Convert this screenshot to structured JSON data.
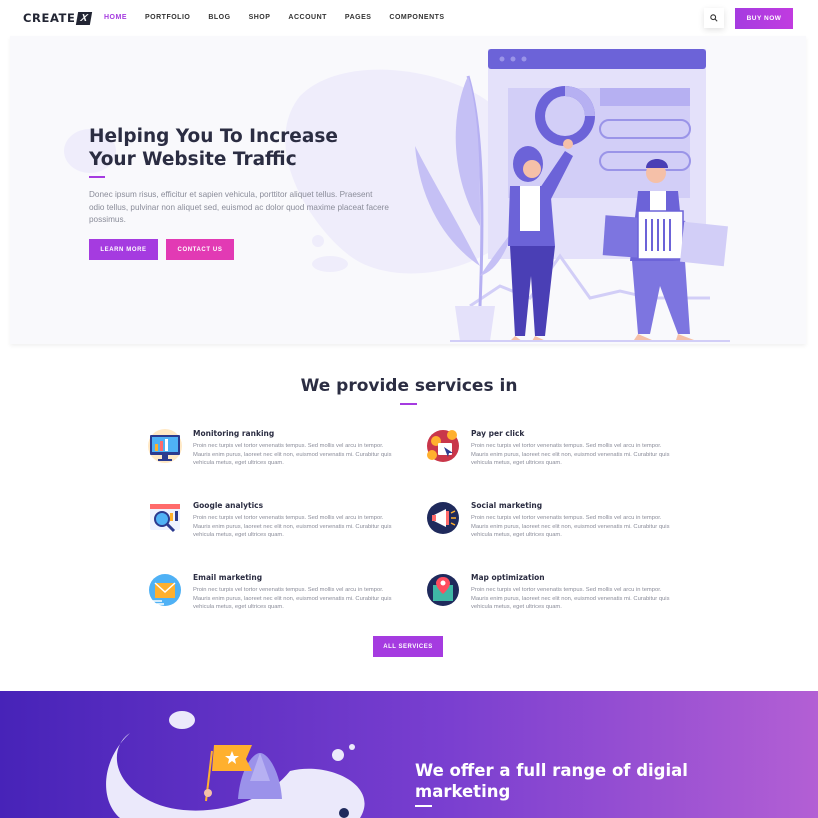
{
  "nav": {
    "logo_text": "CREATE",
    "logo_mark": "X",
    "items": [
      "HOME",
      "PORTFOLIO",
      "BLOG",
      "SHOP",
      "ACCOUNT",
      "PAGES",
      "COMPONENTS"
    ],
    "active_item": "HOME",
    "search_icon": "search-icon",
    "buy_label": "BUY NOW"
  },
  "hero": {
    "title": "Helping You To Increase Your Website Traffic",
    "text": "Donec ipsum risus, efficitur et sapien vehicula, porttitor aliquet tellus. Praesent odio tellus, pulvinar non aliquet sed, euismod ac dolor quod maxime placeat facere possimus.",
    "learn_more": "LEARN MORE",
    "contact_us": "CONTACT US"
  },
  "services": {
    "title": "We provide services in",
    "items": [
      {
        "title": "Monitoring ranking",
        "icon": "monitor-chart-icon",
        "desc": "Proin nec turpis vel tortor venenatis tempus. Sed mollis vel arcu in tempor. Mauris enim purus, laoreet nec elit non, euismod venenatis mi. Curabitur quis vehicula metus, eget ultrices quam."
      },
      {
        "title": "Pay per click",
        "icon": "coins-click-icon",
        "desc": "Proin nec turpis vel tortor venenatis tempus. Sed mollis vel arcu in tempor. Mauris enim purus, laoreet nec elit non, euismod venenatis mi. Curabitur quis vehicula metus, eget ultrices quam."
      },
      {
        "title": "Google analytics",
        "icon": "analytics-magnifier-icon",
        "desc": "Proin nec turpis vel tortor venenatis tempus. Sed mollis vel arcu in tempor. Mauris enim purus, laoreet nec elit non, euismod venenatis mi. Curabitur quis vehicula metus, eget ultrices quam."
      },
      {
        "title": "Social marketing",
        "icon": "megaphone-icon",
        "desc": "Proin nec turpis vel tortor venenatis tempus. Sed mollis vel arcu in tempor. Mauris enim purus, laoreet nec elit non, euismod venenatis mi. Curabitur quis vehicula metus, eget ultrices quam."
      },
      {
        "title": "Email marketing",
        "icon": "envelope-icon",
        "desc": "Proin nec turpis vel tortor venenatis tempus. Sed mollis vel arcu in tempor. Mauris enim purus, laoreet nec elit non, euismod venenatis mi. Curabitur quis vehicula metus, eget ultrices quam."
      },
      {
        "title": "Map optimization",
        "icon": "map-pin-icon",
        "desc": "Proin nec turpis vel tortor venenatis tempus. Sed mollis vel arcu in tempor. Mauris enim purus, laoreet nec elit non, euismod venenatis mi. Curabitur quis vehicula metus, eget ultrices quam."
      }
    ],
    "all_services": "ALL SERVICES"
  },
  "banner": {
    "title": "We offer a full range of digial marketing"
  },
  "colors": {
    "accent": "#a53be0",
    "pink": "#e23ab4",
    "dark": "#2b2d42",
    "illustration": "#6c63d8"
  }
}
